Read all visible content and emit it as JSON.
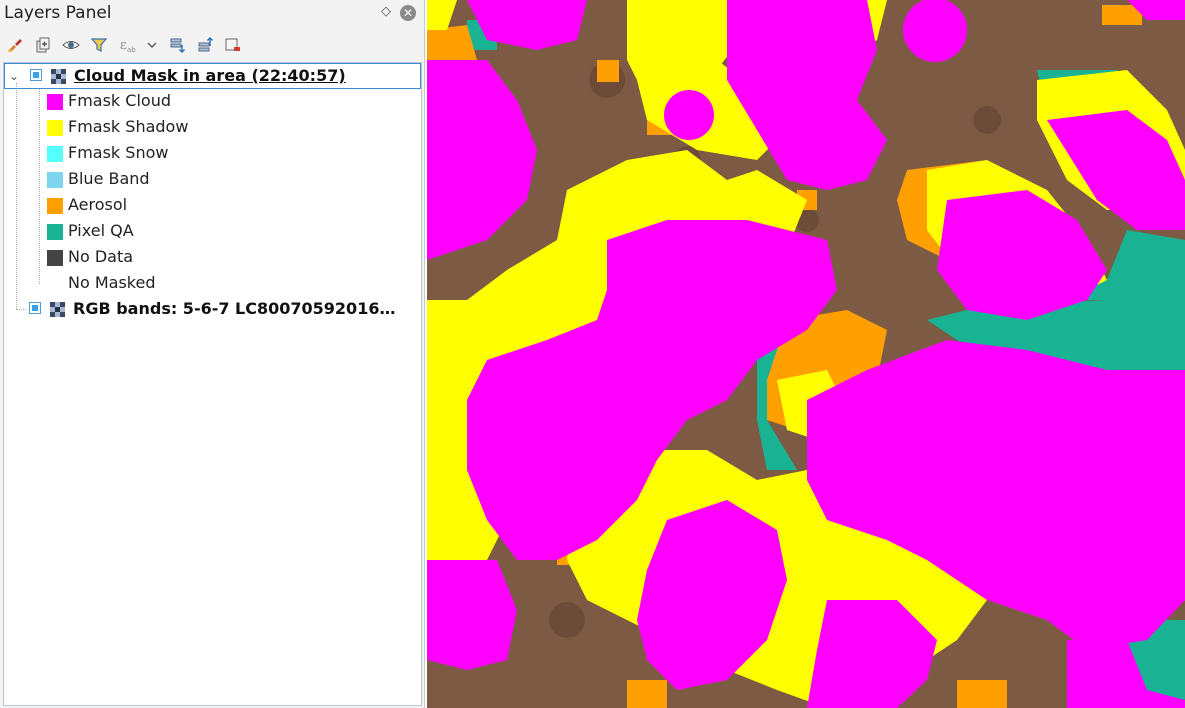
{
  "panel": {
    "title": "Layers Panel",
    "float_icon": "float-dock-icon",
    "close_icon": "close-icon",
    "toolbar": [
      {
        "name": "style-brush-button",
        "icon": "paintbrush-icon"
      },
      {
        "name": "add-group-button",
        "icon": "add-group-icon"
      },
      {
        "name": "visibility-button",
        "icon": "eye-icon"
      },
      {
        "name": "filter-legend-button",
        "icon": "filter-icon"
      },
      {
        "name": "filter-expression-button",
        "icon": "expression-icon"
      },
      {
        "name": "filter-dropdown-button",
        "icon": "chevron-down-icon"
      },
      {
        "name": "expand-all-button",
        "icon": "expand-all-icon"
      },
      {
        "name": "collapse-all-button",
        "icon": "collapse-all-icon"
      },
      {
        "name": "remove-layer-button",
        "icon": "remove-layer-icon"
      }
    ]
  },
  "layers": [
    {
      "name": "Cloud Mask in area (22:40:57)",
      "checked": true,
      "expanded": true,
      "current": true,
      "legend": [
        {
          "label": "Fmask Cloud",
          "color": "#ff00ff"
        },
        {
          "label": "Fmask Shadow",
          "color": "#ffff00"
        },
        {
          "label": "Fmask Snow",
          "color": "#55ffff"
        },
        {
          "label": "Blue Band",
          "color": "#7fd4f0"
        },
        {
          "label": "Aerosol",
          "color": "#ff9f00"
        },
        {
          "label": "Pixel QA",
          "color": "#19b394"
        },
        {
          "label": "No Data",
          "color": "#444444"
        },
        {
          "label": "No Masked",
          "color": ""
        }
      ]
    },
    {
      "name": "RGB bands: 5-6-7 LC80070592016…",
      "checked": true,
      "expanded": false,
      "current": false
    }
  ],
  "map": {
    "colors": {
      "ground": "#7d5a44",
      "cloud": "#ff00ff",
      "shadow": "#ffff00",
      "aerosol": "#ff9f00",
      "pixel_qa": "#19b394"
    }
  }
}
